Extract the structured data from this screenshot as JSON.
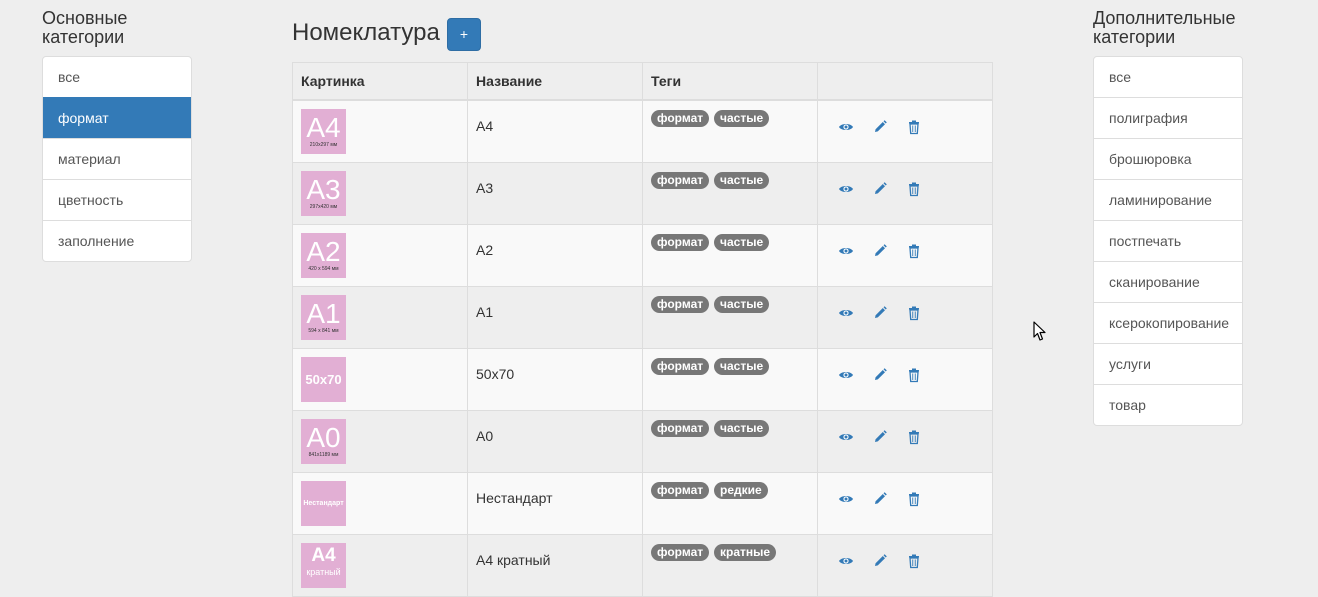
{
  "left": {
    "title": "Основные категории",
    "items": [
      {
        "label": "все",
        "active": false
      },
      {
        "label": "формат",
        "active": true
      },
      {
        "label": "материал",
        "active": false
      },
      {
        "label": "цветность",
        "active": false
      },
      {
        "label": "заполнение",
        "active": false
      }
    ]
  },
  "right": {
    "title": "Дополнительные категории",
    "items": [
      {
        "label": "все"
      },
      {
        "label": "полиграфия"
      },
      {
        "label": "брошюровка"
      },
      {
        "label": "ламинирование"
      },
      {
        "label": "постпечать"
      },
      {
        "label": "сканирование"
      },
      {
        "label": "ксерокопирование"
      },
      {
        "label": "услуги"
      },
      {
        "label": "товар"
      }
    ]
  },
  "main": {
    "title": "Номеклатура",
    "add_label": "+",
    "columns": [
      "Картинка",
      "Название",
      "Теги",
      ""
    ],
    "rows": [
      {
        "thumb_big": "A4",
        "thumb_small": "210x297 мм",
        "name": "A4",
        "tags": [
          "формат",
          "частые"
        ]
      },
      {
        "thumb_big": "A3",
        "thumb_small": "297x420 мм",
        "name": "A3",
        "tags": [
          "формат",
          "частые"
        ]
      },
      {
        "thumb_big": "A2",
        "thumb_small": "420 x 594 мм",
        "name": "A2",
        "tags": [
          "формат",
          "частые"
        ]
      },
      {
        "thumb_big": "A1",
        "thumb_small": "594 x 841 мм",
        "name": "A1",
        "tags": [
          "формат",
          "частые"
        ]
      },
      {
        "thumb_big": "50x70",
        "thumb_small": "",
        "name": "50x70",
        "tags": [
          "формат",
          "частые"
        ]
      },
      {
        "thumb_big": "A0",
        "thumb_small": "841x1189 мм",
        "name": "A0",
        "tags": [
          "формат",
          "частые"
        ]
      },
      {
        "thumb_big": "Нестандарт",
        "thumb_small": "",
        "name": "Нестандарт",
        "tags": [
          "формат",
          "редкие"
        ]
      },
      {
        "thumb_big": "A4",
        "thumb_small": "кратный",
        "name": "A4 кратный",
        "tags": [
          "формат",
          "кратные"
        ]
      }
    ]
  },
  "colors": {
    "accent": "#337ab7",
    "thumb_bg": "#e2afd4",
    "tag_bg": "#777777"
  },
  "icons": [
    "eye-icon",
    "pencil-icon",
    "trash-icon"
  ]
}
